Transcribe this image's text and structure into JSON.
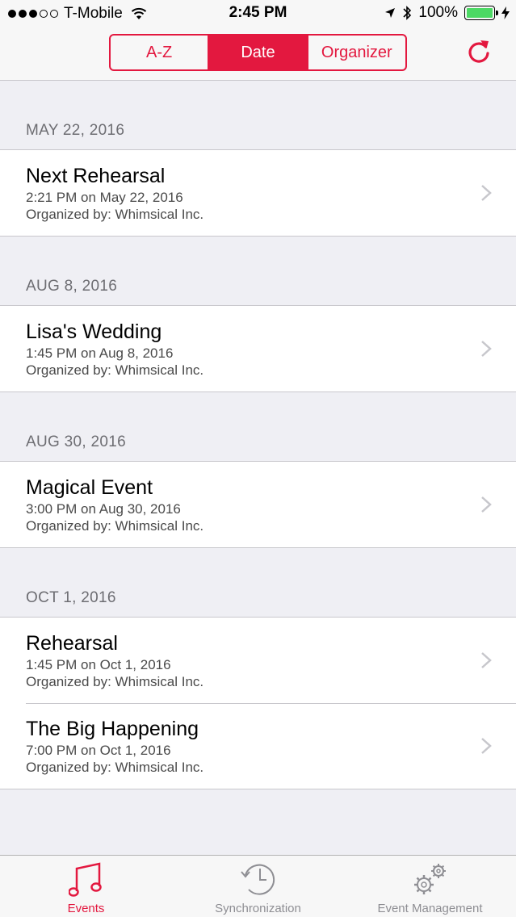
{
  "status_bar": {
    "carrier": "T-Mobile",
    "time": "2:45 PM",
    "battery": "100%"
  },
  "segmented_control": {
    "options": [
      "A-Z",
      "Date",
      "Organizer"
    ],
    "selected": "Date"
  },
  "sections": [
    {
      "header": "MAY 22, 2016",
      "events": [
        {
          "title": "Next Rehearsal",
          "time": "2:21 PM on May 22, 2016",
          "organizer": "Organized by: Whimsical Inc."
        }
      ]
    },
    {
      "header": "AUG 8, 2016",
      "events": [
        {
          "title": "Lisa's Wedding",
          "time": "1:45 PM on Aug 8, 2016",
          "organizer": "Organized by: Whimsical Inc."
        }
      ]
    },
    {
      "header": "AUG 30, 2016",
      "events": [
        {
          "title": "Magical Event",
          "time": "3:00 PM on Aug 30, 2016",
          "organizer": "Organized by: Whimsical Inc."
        }
      ]
    },
    {
      "header": "OCT 1, 2016",
      "events": [
        {
          "title": "Rehearsal",
          "time": "1:45 PM on Oct 1, 2016",
          "organizer": "Organized by: Whimsical Inc."
        },
        {
          "title": "The Big Happening",
          "time": "7:00 PM on Oct 1, 2016",
          "organizer": "Organized by: Whimsical Inc."
        }
      ]
    }
  ],
  "tab_bar": {
    "tabs": [
      {
        "label": "Events",
        "icon": "music-note-icon",
        "active": true
      },
      {
        "label": "Synchronization",
        "icon": "clock-sync-icon",
        "active": false
      },
      {
        "label": "Event Management",
        "icon": "gears-icon",
        "active": false
      }
    ]
  },
  "colors": {
    "accent": "#e3183f",
    "background": "#efeff4",
    "inactive_tab": "#8e8e93"
  }
}
